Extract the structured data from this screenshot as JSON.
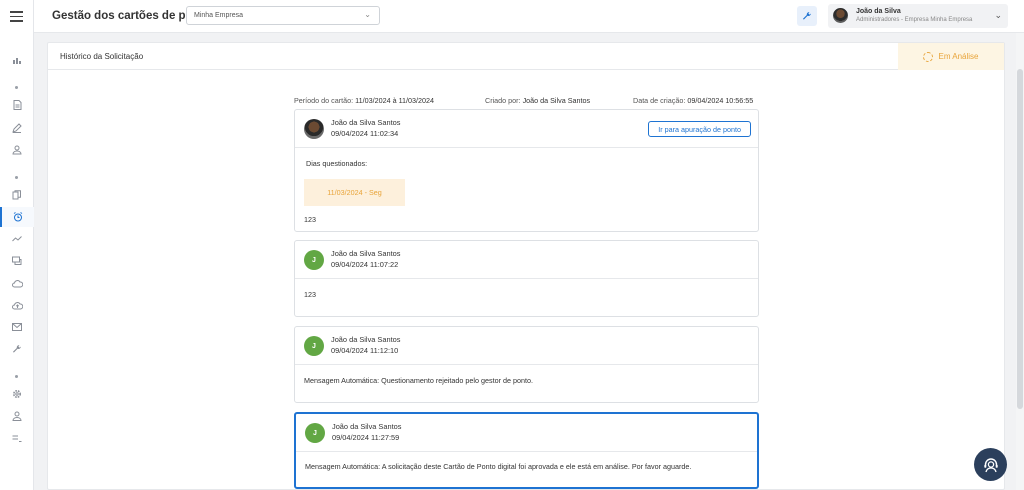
{
  "header": {
    "app_title": "Gestão dos cartões de ponto",
    "company_select_value": "Minha Empresa",
    "user_name": "João da Silva",
    "user_role": "Administradores - Empresa Minha Empresa"
  },
  "sidebar": {
    "items": [
      {
        "icon": "chart-icon"
      },
      {
        "icon": "document-icon"
      },
      {
        "icon": "pencil-icon"
      },
      {
        "icon": "user-icon"
      },
      {
        "icon": "copy-icon"
      },
      {
        "icon": "alarm-clock-icon",
        "active": true
      },
      {
        "icon": "trend-icon"
      },
      {
        "icon": "chat-icon"
      },
      {
        "icon": "cloud-icon"
      },
      {
        "icon": "cloud-upload-icon"
      },
      {
        "icon": "mail-icon"
      },
      {
        "icon": "wrench-icon"
      },
      {
        "icon": "gear-icon"
      },
      {
        "icon": "person-icon"
      },
      {
        "icon": "list-icon"
      }
    ]
  },
  "card": {
    "title": "Histórico da Solicitação",
    "status": "Em Análise",
    "status_color": "#e8a43a"
  },
  "meta": {
    "period_label": "Período do cartão:",
    "period_value": "11/03/2024 à 11/03/2024",
    "created_by_label": "Criado por:",
    "created_by_value": "João da Silva Santos",
    "created_at_label": "Data de criação:",
    "created_at_value": "09/04/2024 10:56:55"
  },
  "messages": [
    {
      "author": "João da Silva Santos",
      "date": "09/04/2024 11:02:34",
      "avatar": "photo",
      "button_label": "Ir para apuração de ponto",
      "questioned_label": "Dias questionados:",
      "questioned_day": "11/03/2024 - Seg",
      "text": "123"
    },
    {
      "author": "João da Silva Santos",
      "date": "09/04/2024 11:07:22",
      "avatar_initial": "J",
      "text": "123"
    },
    {
      "author": "João da Silva Santos",
      "date": "09/04/2024 11:12:10",
      "avatar_initial": "J",
      "text": "Mensagem Automática: Questionamento rejeitado pelo gestor de ponto."
    },
    {
      "author": "João da Silva Santos",
      "date": "09/04/2024 11:27:59",
      "avatar_initial": "J",
      "text": "Mensagem Automática: A solicitação deste Cartão de Ponto digital foi aprovada e ele está em análise. Por favor aguarde."
    }
  ],
  "colors": {
    "accent": "#1e73d2",
    "avatar_green": "#62a744",
    "pending_bg": "#fdf0dc"
  }
}
